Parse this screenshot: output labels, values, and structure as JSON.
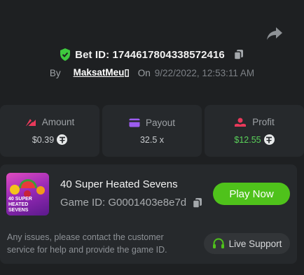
{
  "bet": {
    "label": "Bet ID: 1744617804338572416",
    "by": "By",
    "user": "MaksatMeu▯",
    "on": "On",
    "time": "9/22/2022, 12:53:11 AM"
  },
  "stats": [
    {
      "label": "Amount",
      "value": "$0.39",
      "currency_icon": "tether-icon",
      "color": "#e8395a"
    },
    {
      "label": "Payout",
      "value": "32.5 x",
      "currency_icon": "",
      "color": "#9c5cf0"
    },
    {
      "label": "Profit",
      "value": "$12.55",
      "currency_icon": "tether-icon",
      "color": "#e8395a",
      "value_color": "#5ad25a"
    }
  ],
  "game": {
    "title": "40 Super Heated Sevens",
    "id": "Game ID: G0001403e8e7d",
    "thumb_text": "40 SUPER HEATED SEVENS",
    "play_label": "Play Now",
    "note": "Any issues, please contact the customer service for help and provide the game ID.",
    "support_label": "Live Support"
  },
  "colors": {
    "accent_green": "#4fc21b",
    "background": "#1e2022",
    "card": "#26292c"
  }
}
